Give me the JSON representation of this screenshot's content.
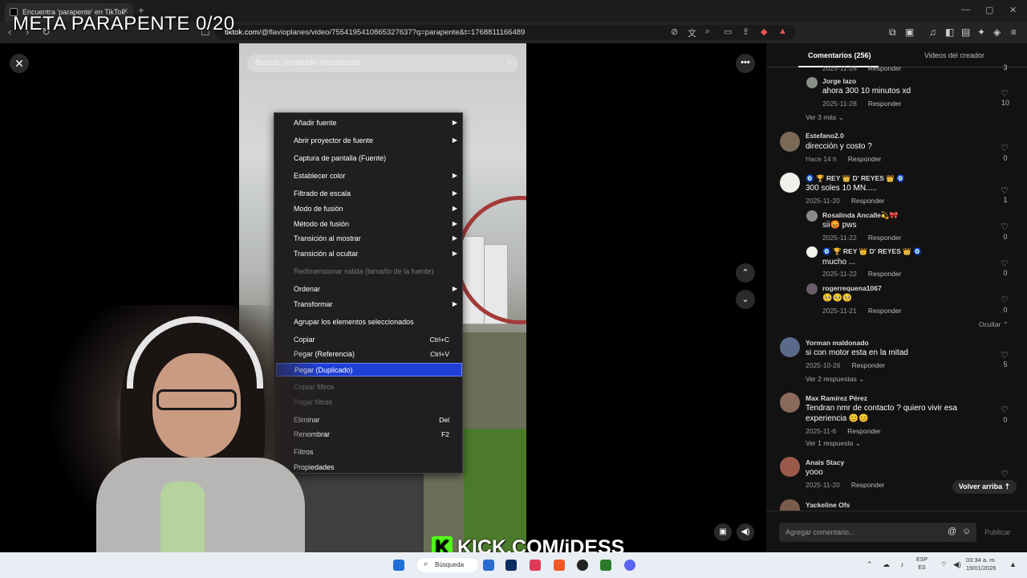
{
  "overlay": {
    "goal": "META PARAPENTE 0/20",
    "stream_url": "KICK.COM/iDESS",
    "kick_logo": "K"
  },
  "browser": {
    "tab_title": "Encuentra 'parapente' en TikTok",
    "url_host": "tiktok.com",
    "url_path": "/@flavioplanes/video/7554195410865327637?q=parapente&t=1768811166489"
  },
  "video": {
    "search_placeholder": "Buscar contenido relacionado"
  },
  "context_menu": {
    "items": [
      {
        "label": "Añadir fuente",
        "submenu": true
      },
      {
        "label": "Abrir proyector de fuente",
        "submenu": true
      },
      {
        "label": "Captura de pantalla (Fuente)"
      },
      {
        "label": "Establecer color",
        "submenu": true
      },
      {
        "label": "Filtrado de escala",
        "submenu": true
      },
      {
        "label": "Modo de fusión",
        "submenu": true
      },
      {
        "label": "Método de fusión",
        "submenu": true
      },
      {
        "label": "Transición al mostrar",
        "submenu": true
      },
      {
        "label": "Transición al ocultar",
        "submenu": true
      },
      {
        "label": "Redimensionar salida (tamaño de la fuente)",
        "disabled": true
      },
      {
        "label": "Ordenar",
        "submenu": true
      },
      {
        "label": "Transformar",
        "submenu": true
      },
      {
        "label": "Agrupar los elementos seleccionados"
      },
      {
        "label": "Copiar",
        "shortcut": "Ctrl+C"
      },
      {
        "label": "Pegar (Referencia)",
        "shortcut": "Ctrl+V"
      },
      {
        "label": "Pegar (Duplicado)",
        "selected": true
      },
      {
        "label": "Copiar filtros",
        "disabled": true
      },
      {
        "label": "Pegar filtros",
        "disabled": true
      },
      {
        "label": "Eliminar",
        "shortcut": "Del"
      },
      {
        "label": "Renombrar",
        "shortcut": "F2"
      },
      {
        "label": "Filtros"
      },
      {
        "label": "Propiedades"
      }
    ]
  },
  "comments_panel": {
    "tab_comments": "Comentarios (256)",
    "tab_videos": "Videos del creador",
    "reply_label": "Responder",
    "comments": [
      {
        "user": "Jorge lazo",
        "text": "ahora 300 10 minutos xd",
        "date": "2025-11-28",
        "likes": "10"
      },
      {
        "user": "Estefano2.0",
        "text": "dirección y costo ?",
        "date": "Hace 14 h",
        "likes": "0"
      },
      {
        "user": "🧿 🏆 REY 👑 D' REYES 👑 🧿",
        "text": "300 soles 10 MN.....",
        "date": "2025-11-20",
        "likes": "1"
      },
      {
        "user": "Rosalinda Ancalle💫🎀",
        "text": "sii😡 pws",
        "date": "2025-11-22",
        "likes": "0"
      },
      {
        "user": "🧿 🏆 REY 👑 D' REYES 👑 🧿",
        "text": "mucho ...",
        "date": "2025-11-22",
        "likes": "0"
      },
      {
        "user": "rogerrequena1067",
        "text": "🥺🥺🥺",
        "date": "2025-11-21",
        "likes": "0"
      },
      {
        "user": "Yorman maldonado",
        "text": "si con motor esta en la mitad",
        "date": "2025-10-26",
        "likes": "5"
      },
      {
        "user": "Max Ramírez Pérez",
        "text": "Tendran nmr de contacto ? quiero vivir esa",
        "text2": "experiencia 😊😊",
        "date": "2025-11-6",
        "likes": "0"
      },
      {
        "user": "Anais Stacy",
        "text": "yooo",
        "date": "2025-11-20",
        "likes": ""
      },
      {
        "user": "Yackeline Ofs",
        "text": "",
        "date": "",
        "likes": ""
      }
    ],
    "top_date": "2025-11-28",
    "top_likes": "3",
    "see_more_1": "Ver 3 más",
    "hide": "Ocultar",
    "see_replies_2": "Ver 2 respuestas",
    "see_reply_1": "Ver 1 respuesta",
    "back_to_top": "Volver arriba",
    "add_comment_placeholder": "Agregar comentario...",
    "publish": "Publicar"
  },
  "taskbar": {
    "search": "Búsqueda",
    "lang_top": "ESP",
    "lang_bottom": "ES",
    "time": "03:34 a. m.",
    "date": "19/01/2026"
  }
}
